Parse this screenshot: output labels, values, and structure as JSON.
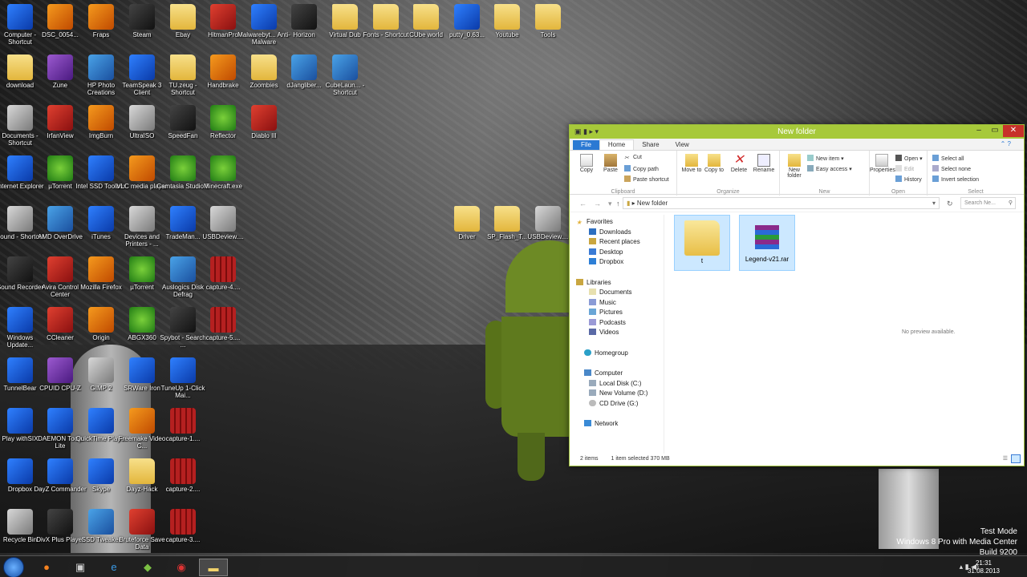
{
  "desktop_icons": [
    {
      "label": "Computer - Shortcut",
      "icon": "computer-icon"
    },
    {
      "label": "DSC_0054...",
      "icon": "vlc-icon"
    },
    {
      "label": "Fraps",
      "icon": "fraps-icon"
    },
    {
      "label": "Steam",
      "icon": "steam-icon"
    },
    {
      "label": "Ebay",
      "icon": "folder-icon"
    },
    {
      "label": "HitmanPro",
      "icon": "hitmanpro-icon"
    },
    {
      "label": "Malwarebyt... Anti-Malware",
      "icon": "malwarebytes-icon"
    },
    {
      "label": "Horizon",
      "icon": "xbox-icon"
    },
    {
      "label": "Virtual Dub",
      "icon": "folder-icon"
    },
    {
      "label": "Fonts - Shortcut",
      "icon": "folder-icon"
    },
    {
      "label": "CUbe world",
      "icon": "folder-icon"
    },
    {
      "label": "putty_0.63...",
      "icon": "putty-icon"
    },
    {
      "label": "Youtube",
      "icon": "folder-icon"
    },
    {
      "label": "Tools",
      "icon": "folder-icon"
    },
    {
      "label": "download",
      "icon": "folder-icon"
    },
    {
      "label": "Zune",
      "icon": "zune-icon"
    },
    {
      "label": "HP Photo Creations",
      "icon": "hp-photo-icon"
    },
    {
      "label": "TeamSpeak 3 Client",
      "icon": "teamspeak-icon"
    },
    {
      "label": "TU.zeug - Shortcut",
      "icon": "folder-icon"
    },
    {
      "label": "Handbrake",
      "icon": "handbrake-icon"
    },
    {
      "label": "Zoombies",
      "icon": "folder-icon"
    },
    {
      "label": "dJangliber...",
      "icon": "app-icon"
    },
    {
      "label": "CubeLaun... - Shortcut",
      "icon": "cubelauncher-icon"
    },
    {
      "label": "Documents - Shortcut",
      "icon": "documents-icon"
    },
    {
      "label": "IrfanView",
      "icon": "irfanview-icon"
    },
    {
      "label": "ImgBurn",
      "icon": "imgburn-icon"
    },
    {
      "label": "UltraISO",
      "icon": "ultraiso-icon"
    },
    {
      "label": "SpeedFan",
      "icon": "speedfan-icon"
    },
    {
      "label": "Reflector",
      "icon": "reflector-icon"
    },
    {
      "label": "Diablo III",
      "icon": "diablo-icon"
    },
    {
      "label": "Internet Explorer",
      "icon": "ie-icon"
    },
    {
      "label": "µTorrent",
      "icon": "utorrent-icon"
    },
    {
      "label": "Intel SSD Toolbox",
      "icon": "intel-icon"
    },
    {
      "label": "VLC media player",
      "icon": "vlc-icon"
    },
    {
      "label": "Camtasia Studio 8",
      "icon": "camtasia-icon"
    },
    {
      "label": "Minecraft.exe",
      "icon": "minecraft-icon"
    },
    {
      "label": "Sound - Shortcut",
      "icon": "sound-icon"
    },
    {
      "label": "AMD OverDrive",
      "icon": "amd-icon"
    },
    {
      "label": "iTunes",
      "icon": "itunes-icon"
    },
    {
      "label": "Devices and Printers - ...",
      "icon": "devices-icon"
    },
    {
      "label": "TradeMan...",
      "icon": "trademanager-icon"
    },
    {
      "label": "USBDeview....",
      "icon": "usbdeview-icon"
    },
    {
      "label": "Sound Recorder",
      "icon": "microphone-icon"
    },
    {
      "label": "Avira Control Center",
      "icon": "avira-icon"
    },
    {
      "label": "Mozilla Firefox",
      "icon": "firefox-icon"
    },
    {
      "label": "µTorrent",
      "icon": "utorrent-icon"
    },
    {
      "label": "Auslogics Disk Defrag",
      "icon": "auslogics-icon"
    },
    {
      "label": "capture-4....",
      "icon": "video-file-icon"
    },
    {
      "label": "Windows Update...",
      "icon": "windows-update-icon"
    },
    {
      "label": "CCleaner",
      "icon": "ccleaner-icon"
    },
    {
      "label": "Origin",
      "icon": "origin-icon"
    },
    {
      "label": "ABGX360",
      "icon": "abgx-icon"
    },
    {
      "label": "Spybot - Search ...",
      "icon": "spybot-icon"
    },
    {
      "label": "capture-5....",
      "icon": "video-file-icon"
    },
    {
      "label": "TunnelBear",
      "icon": "tunnelbear-icon"
    },
    {
      "label": "CPUID CPU-Z",
      "icon": "cpuz-icon"
    },
    {
      "label": "GIMP 2",
      "icon": "gimp-icon"
    },
    {
      "label": "SRWare Iron",
      "icon": "srware-icon"
    },
    {
      "label": "TuneUp 1-Click Mai...",
      "icon": "tuneup-icon"
    },
    {
      "label": "Play withSIX",
      "icon": "playwithsix-icon"
    },
    {
      "label": "DAEMON Tools Lite",
      "icon": "daemon-icon"
    },
    {
      "label": "QuickTime Player",
      "icon": "quicktime-icon"
    },
    {
      "label": "Freemake Video C...",
      "icon": "freemake-icon"
    },
    {
      "label": "capture-1....",
      "icon": "video-file-icon"
    },
    {
      "label": "Dropbox",
      "icon": "dropbox-icon"
    },
    {
      "label": "DayZ Commander",
      "icon": "dayz-icon"
    },
    {
      "label": "Skype",
      "icon": "skype-icon"
    },
    {
      "label": "Dayz-Hack",
      "icon": "folder-icon"
    },
    {
      "label": "capture-2....",
      "icon": "video-file-icon"
    },
    {
      "label": "Recycle Bin",
      "icon": "recycle-bin-icon"
    },
    {
      "label": "DivX Plus Player",
      "icon": "divx-icon"
    },
    {
      "label": "SSD Tweaker",
      "icon": "ssd-tweaker-icon"
    },
    {
      "label": "Bruteforce Save Data",
      "icon": "bruteforce-icon"
    },
    {
      "label": "capture-3....",
      "icon": "video-file-icon"
    },
    {
      "label": "Driver",
      "icon": "folder-icon"
    },
    {
      "label": "SP_Flash_T...",
      "icon": "folder-icon"
    },
    {
      "label": "USBDeview....",
      "icon": "usbdeview-icon"
    }
  ],
  "explorer": {
    "title": "New folder",
    "tabs": {
      "file": "File",
      "home": "Home",
      "share": "Share",
      "view": "View"
    },
    "ribbon": {
      "copy": "Copy",
      "paste": "Paste",
      "cut": "Cut",
      "copy_path": "Copy path",
      "paste_shortcut": "Paste shortcut",
      "clipboard": "Clipboard",
      "move_to": "Move to",
      "copy_to": "Copy to",
      "delete": "Delete",
      "rename": "Rename",
      "organize": "Organize",
      "new_folder": "New folder",
      "new_item": "New item",
      "easy_access": "Easy access",
      "new": "New",
      "properties": "Properties",
      "open": "Open",
      "edit": "Edit",
      "history": "History",
      "open_group": "Open",
      "select_all": "Select all",
      "select_none": "Select none",
      "invert_selection": "Invert selection",
      "select": "Select"
    },
    "address": "New folder",
    "search_placeholder": "Search Ne...",
    "nav": {
      "favorites": "Favorites",
      "downloads": "Downloads",
      "recent_places": "Recent places",
      "desktop": "Desktop",
      "dropbox": "Dropbox",
      "libraries": "Libraries",
      "documents": "Documents",
      "music": "Music",
      "pictures": "Pictures",
      "podcasts": "Podcasts",
      "videos": "Videos",
      "homegroup": "Homegroup",
      "computer": "Computer",
      "local_disk": "Local Disk (C:)",
      "new_volume": "New Volume (D:)",
      "cd_drive": "CD Drive (G:)",
      "network": "Network"
    },
    "files": [
      {
        "name": "t",
        "type": "folder"
      },
      {
        "name": "Legend-v21.rar",
        "type": "rar"
      }
    ],
    "preview": "No preview available.",
    "status": {
      "count": "2 items",
      "selected": "1 item selected  370 MB"
    }
  },
  "watermark": {
    "line1": "Test Mode",
    "line2": "Windows 8 Pro with Media Center",
    "line3": "Build 9200"
  },
  "clock": {
    "time": "21:31",
    "date": "31.08.2013"
  }
}
